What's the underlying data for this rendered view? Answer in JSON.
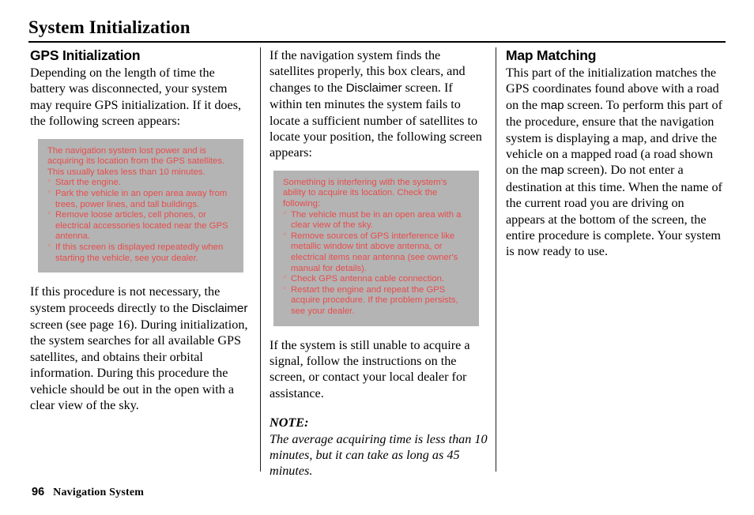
{
  "header": {
    "title": "System Initialization"
  },
  "columns": {
    "left": {
      "heading": "GPS Initialization",
      "intro": "Depending on the length of time the battery was disconnected, your system may require GPS initialization. If it does, the following screen appears:",
      "message_box": {
        "intro": "The navigation system lost power and is acquiring its location from the GPS satellites. This usually takes less than 10 minutes.",
        "bullet_marker": "*",
        "bullets": [
          "Start the engine.",
          "Park the vehicle in an open area away from trees, power lines, and tall buildings.",
          "Remove loose articles, cell phones, or electrical accessories located near the GPS antenna.",
          "If this screen is displayed repeatedly when starting the vehicle, see your dealer."
        ]
      },
      "after_box_1": "If this procedure is not necessary, the system proceeds directly to the ",
      "after_box_term": "Disclaimer",
      "after_box_2": " screen (see page 16). During initialization, the system searches for all available GPS satellites, and obtains their orbital information. During this procedure the vehicle should be out in the open with a clear view of the sky."
    },
    "middle": {
      "intro_1": "If the navigation system finds the satellites properly, this box clears, and changes to the ",
      "intro_term": "Disclaimer",
      "intro_2": " screen. If within ten minutes the system fails to locate a sufficient number of satellites to locate your position, the following screen appears:",
      "message_box": {
        "intro": "Something is interfering with the system's ability to acquire its location. Check the following:",
        "bullet_marker": "*",
        "bullets": [
          "The vehicle must be in an open area with a clear view of the sky.",
          "Remove sources of GPS interference like metallic window tint above antenna, or electrical items near antenna (see owner's manual for details).",
          "Check GPS antenna cable connection.",
          "Restart the engine and repeat the GPS acquire procedure. If the problem persists, see your dealer."
        ]
      },
      "after_box": "If the system is still unable to acquire a signal, follow the instructions on the screen, or contact your local dealer for assistance.",
      "note_label": "NOTE:",
      "note_body": "The average acquiring time is less than 10 minutes, but it can take as long as 45 minutes."
    },
    "right": {
      "heading": "Map Matching",
      "para_1": "This part of the initialization matches the GPS coordinates found above with a road on the ",
      "term_1": "map",
      "para_2": " screen. To perform this part of the procedure, ensure that the navigation system is displaying a map, and drive the vehicle on a mapped road (a road shown on the ",
      "term_2": "map",
      "para_3": " screen). Do not enter a destination at this time. When the name of the current road you are driving on appears at the bottom of the screen, the entire procedure is complete. Your system is now ready to use."
    }
  },
  "footer": {
    "page_number": "96",
    "label": "Navigation System"
  },
  "colors": {
    "message_box_background": "#b4b4b4",
    "message_text": "#e84c4c",
    "rule": "#000000"
  }
}
